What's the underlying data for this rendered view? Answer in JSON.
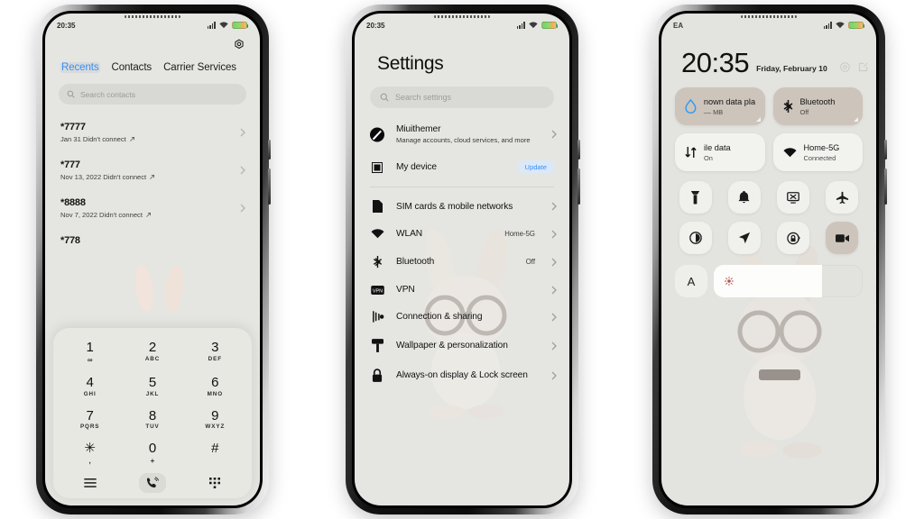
{
  "status_bar": {
    "time": "20:35",
    "carrier": "EA",
    "signal_icon": "signal-bars-icon",
    "wifi_icon": "wifi-icon",
    "battery_icon": "battery-icon"
  },
  "phone1": {
    "app": "Phone",
    "settings_icon": "gear-icon",
    "tabs": [
      {
        "label": "Recents",
        "active": true
      },
      {
        "label": "Contacts",
        "active": false
      },
      {
        "label": "Carrier Services",
        "active": false
      }
    ],
    "search": {
      "placeholder": "Search contacts",
      "icon": "search-icon"
    },
    "calls": [
      {
        "number": "*7777",
        "detail": "Jan 31 Didn't connect",
        "arrow": "outgoing-arrow-icon"
      },
      {
        "number": "*777",
        "detail": "Nov 13, 2022 Didn't connect",
        "arrow": "outgoing-arrow-icon"
      },
      {
        "number": "*8888",
        "detail": "Nov 7, 2022 Didn't connect",
        "arrow": "outgoing-arrow-icon"
      },
      {
        "number": "*778",
        "detail": "",
        "arrow": "outgoing-arrow-icon"
      }
    ],
    "dialpad": {
      "keys": [
        {
          "digit": "1",
          "letters": "∞"
        },
        {
          "digit": "2",
          "letters": "ABC"
        },
        {
          "digit": "3",
          "letters": "DEF"
        },
        {
          "digit": "4",
          "letters": "GHI"
        },
        {
          "digit": "5",
          "letters": "JKL"
        },
        {
          "digit": "6",
          "letters": "MNO"
        },
        {
          "digit": "7",
          "letters": "PQRS"
        },
        {
          "digit": "8",
          "letters": "TUV"
        },
        {
          "digit": "9",
          "letters": "WXYZ"
        },
        {
          "digit": "✳",
          "letters": ","
        },
        {
          "digit": "0",
          "letters": "+"
        },
        {
          "digit": "#",
          "letters": ""
        }
      ],
      "actions": {
        "menu_icon": "menu-icon",
        "call_icon": "call-icon",
        "keypad_icon": "keypad-icon"
      }
    }
  },
  "phone2": {
    "title": "Settings",
    "search": {
      "placeholder": "Search settings",
      "icon": "search-icon"
    },
    "account": {
      "name": "Miuithemer",
      "subtitle": "Manage accounts, cloud services, and more",
      "avatar_icon": "account-avatar-icon"
    },
    "device": {
      "label": "My device",
      "badge": "Update",
      "icon": "device-icon"
    },
    "items": [
      {
        "label": "SIM cards & mobile networks",
        "value": "",
        "icon": "sim-card-icon"
      },
      {
        "label": "WLAN",
        "value": "Home-5G",
        "icon": "wifi-icon"
      },
      {
        "label": "Bluetooth",
        "value": "Off",
        "icon": "bluetooth-icon"
      },
      {
        "label": "VPN",
        "value": "",
        "icon": "vpn-icon"
      },
      {
        "label": "Connection & sharing",
        "value": "",
        "icon": "connection-sharing-icon"
      },
      {
        "label": "Wallpaper & personalization",
        "value": "",
        "icon": "wallpaper-icon"
      },
      {
        "label": "Always-on display & Lock screen",
        "value": "",
        "icon": "lock-icon"
      }
    ],
    "chevron_icon": "chevron-right-icon"
  },
  "phone3": {
    "clock": {
      "time": "20:35",
      "date": "Friday, February 10"
    },
    "header_icons": [
      {
        "name": "settings-circle-icon"
      },
      {
        "name": "edit-icon"
      }
    ],
    "tiles": [
      {
        "label": "nown data pla",
        "sub": "–– MB",
        "icon": "data-usage-icon",
        "state": "on"
      },
      {
        "label": "Bluetooth",
        "sub": "Off",
        "icon": "bluetooth-icon",
        "state": "on"
      },
      {
        "label": "ile data",
        "sub": "On",
        "icon": "mobile-data-icon",
        "state": "off"
      },
      {
        "label": "Home-5G",
        "sub": "Connected",
        "icon": "wifi-icon",
        "state": "off"
      }
    ],
    "toggles": [
      {
        "icon": "flashlight-icon",
        "active": false
      },
      {
        "icon": "bell-icon",
        "active": false
      },
      {
        "icon": "screencast-icon",
        "active": false
      },
      {
        "icon": "airplane-icon",
        "active": false
      },
      {
        "icon": "dark-mode-icon",
        "active": false
      },
      {
        "icon": "location-icon",
        "active": false
      },
      {
        "icon": "rotation-lock-icon",
        "active": false
      },
      {
        "icon": "screen-record-icon",
        "active": true
      }
    ],
    "brightness": {
      "label": "A",
      "icon": "sun-icon",
      "percent": 73
    }
  },
  "colors": {
    "accent": "#3a8ef6",
    "tile_on": "#cdc4bb",
    "screen_bg": "#e5e5e1",
    "badge_bg": "#dbe8f8"
  }
}
